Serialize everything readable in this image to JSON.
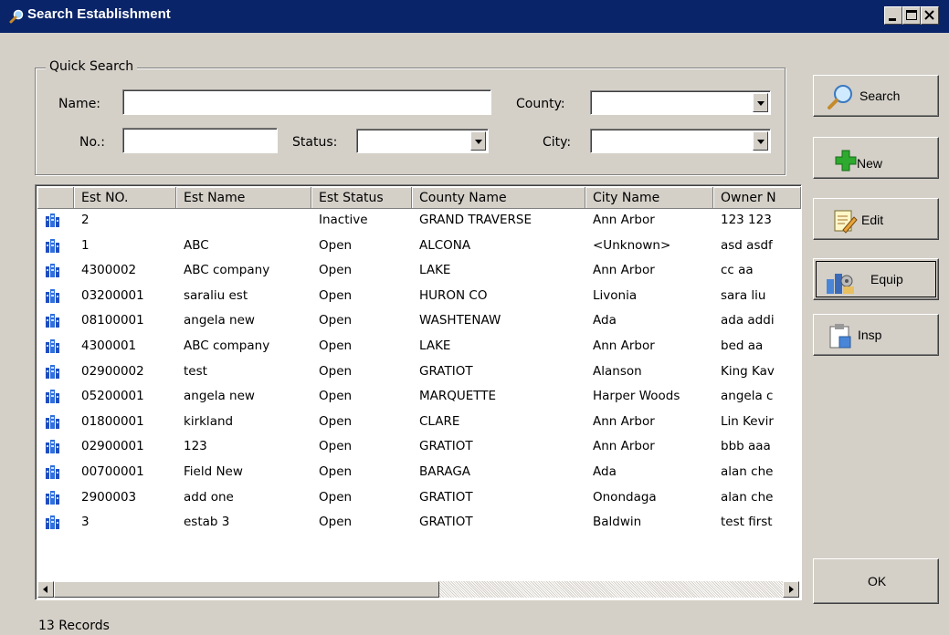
{
  "window": {
    "title": "Search Establishment"
  },
  "quick_search": {
    "legend": "Quick Search",
    "name_label": "Name:",
    "name_value": "",
    "no_label": "No.:",
    "no_value": "",
    "status_label": "Status:",
    "status_value": "",
    "county_label": "County:",
    "county_value": "",
    "city_label": "City:",
    "city_value": ""
  },
  "buttons": {
    "search": "Search",
    "new": "New",
    "edit": "Edit",
    "equip": "Equip",
    "insp": "Insp",
    "ok": "OK"
  },
  "table": {
    "columns": [
      "Est NO.",
      "Est Name",
      "Est Status",
      "County Name",
      "City Name",
      "Owner N"
    ],
    "rows": [
      {
        "no": "2",
        "name": "",
        "status": "Inactive",
        "county": "GRAND TRAVERSE",
        "city": "Ann Arbor",
        "owner": "123 123"
      },
      {
        "no": "1",
        "name": "ABC",
        "status": "Open",
        "county": "ALCONA",
        "city": "<Unknown>",
        "owner": "asd asdf"
      },
      {
        "no": "4300002",
        "name": "ABC company",
        "status": "Open",
        "county": "LAKE",
        "city": "Ann Arbor",
        "owner": "cc aa"
      },
      {
        "no": "03200001",
        "name": "saraliu est",
        "status": "Open",
        "county": "HURON CO",
        "city": "Livonia",
        "owner": "sara liu"
      },
      {
        "no": "08100001",
        "name": "angela new",
        "status": "Open",
        "county": "WASHTENAW",
        "city": "Ada",
        "owner": "ada addi"
      },
      {
        "no": "4300001",
        "name": "ABC company",
        "status": "Open",
        "county": "LAKE",
        "city": "Ann Arbor",
        "owner": "bed aa"
      },
      {
        "no": "02900002",
        "name": "test",
        "status": "Open",
        "county": "GRATIOT",
        "city": "Alanson",
        "owner": "King Kav"
      },
      {
        "no": "05200001",
        "name": "angela new",
        "status": "Open",
        "county": "MARQUETTE",
        "city": "Harper Woods",
        "owner": "angela c"
      },
      {
        "no": "01800001",
        "name": "kirkland",
        "status": "Open",
        "county": "CLARE",
        "city": "Ann Arbor",
        "owner": "Lin Kevir"
      },
      {
        "no": "02900001",
        "name": "123",
        "status": "Open",
        "county": "GRATIOT",
        "city": "Ann Arbor",
        "owner": "bbb aaa"
      },
      {
        "no": "00700001",
        "name": "Field New",
        "status": "Open",
        "county": "BARAGA",
        "city": "Ada",
        "owner": "alan che"
      },
      {
        "no": "2900003",
        "name": "add one",
        "status": "Open",
        "county": "GRATIOT",
        "city": "Onondaga",
        "owner": "alan che"
      },
      {
        "no": "3",
        "name": "estab 3",
        "status": "Open",
        "county": "GRATIOT",
        "city": "Baldwin",
        "owner": "test first"
      }
    ]
  },
  "status_bar": {
    "records": "13 Records"
  }
}
